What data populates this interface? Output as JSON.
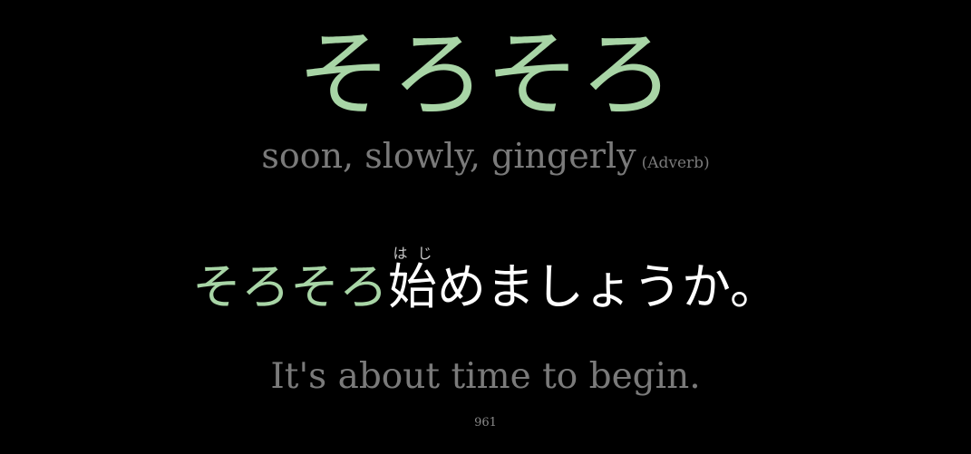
{
  "card": {
    "word": "そろそろ",
    "meaning": "soon, slowly, gingerly",
    "part_of_speech": "(Adverb)",
    "example": {
      "highlight": "そろそろ",
      "kanji": "始",
      "furigana": "はじ",
      "rest": "めましょうか。"
    },
    "translation": "It's about time to begin.",
    "number": "961"
  },
  "colors": {
    "background": "#000000",
    "highlight": "#a8d5a6",
    "muted": "#7a7a7a",
    "sentence": "#ffffff"
  }
}
